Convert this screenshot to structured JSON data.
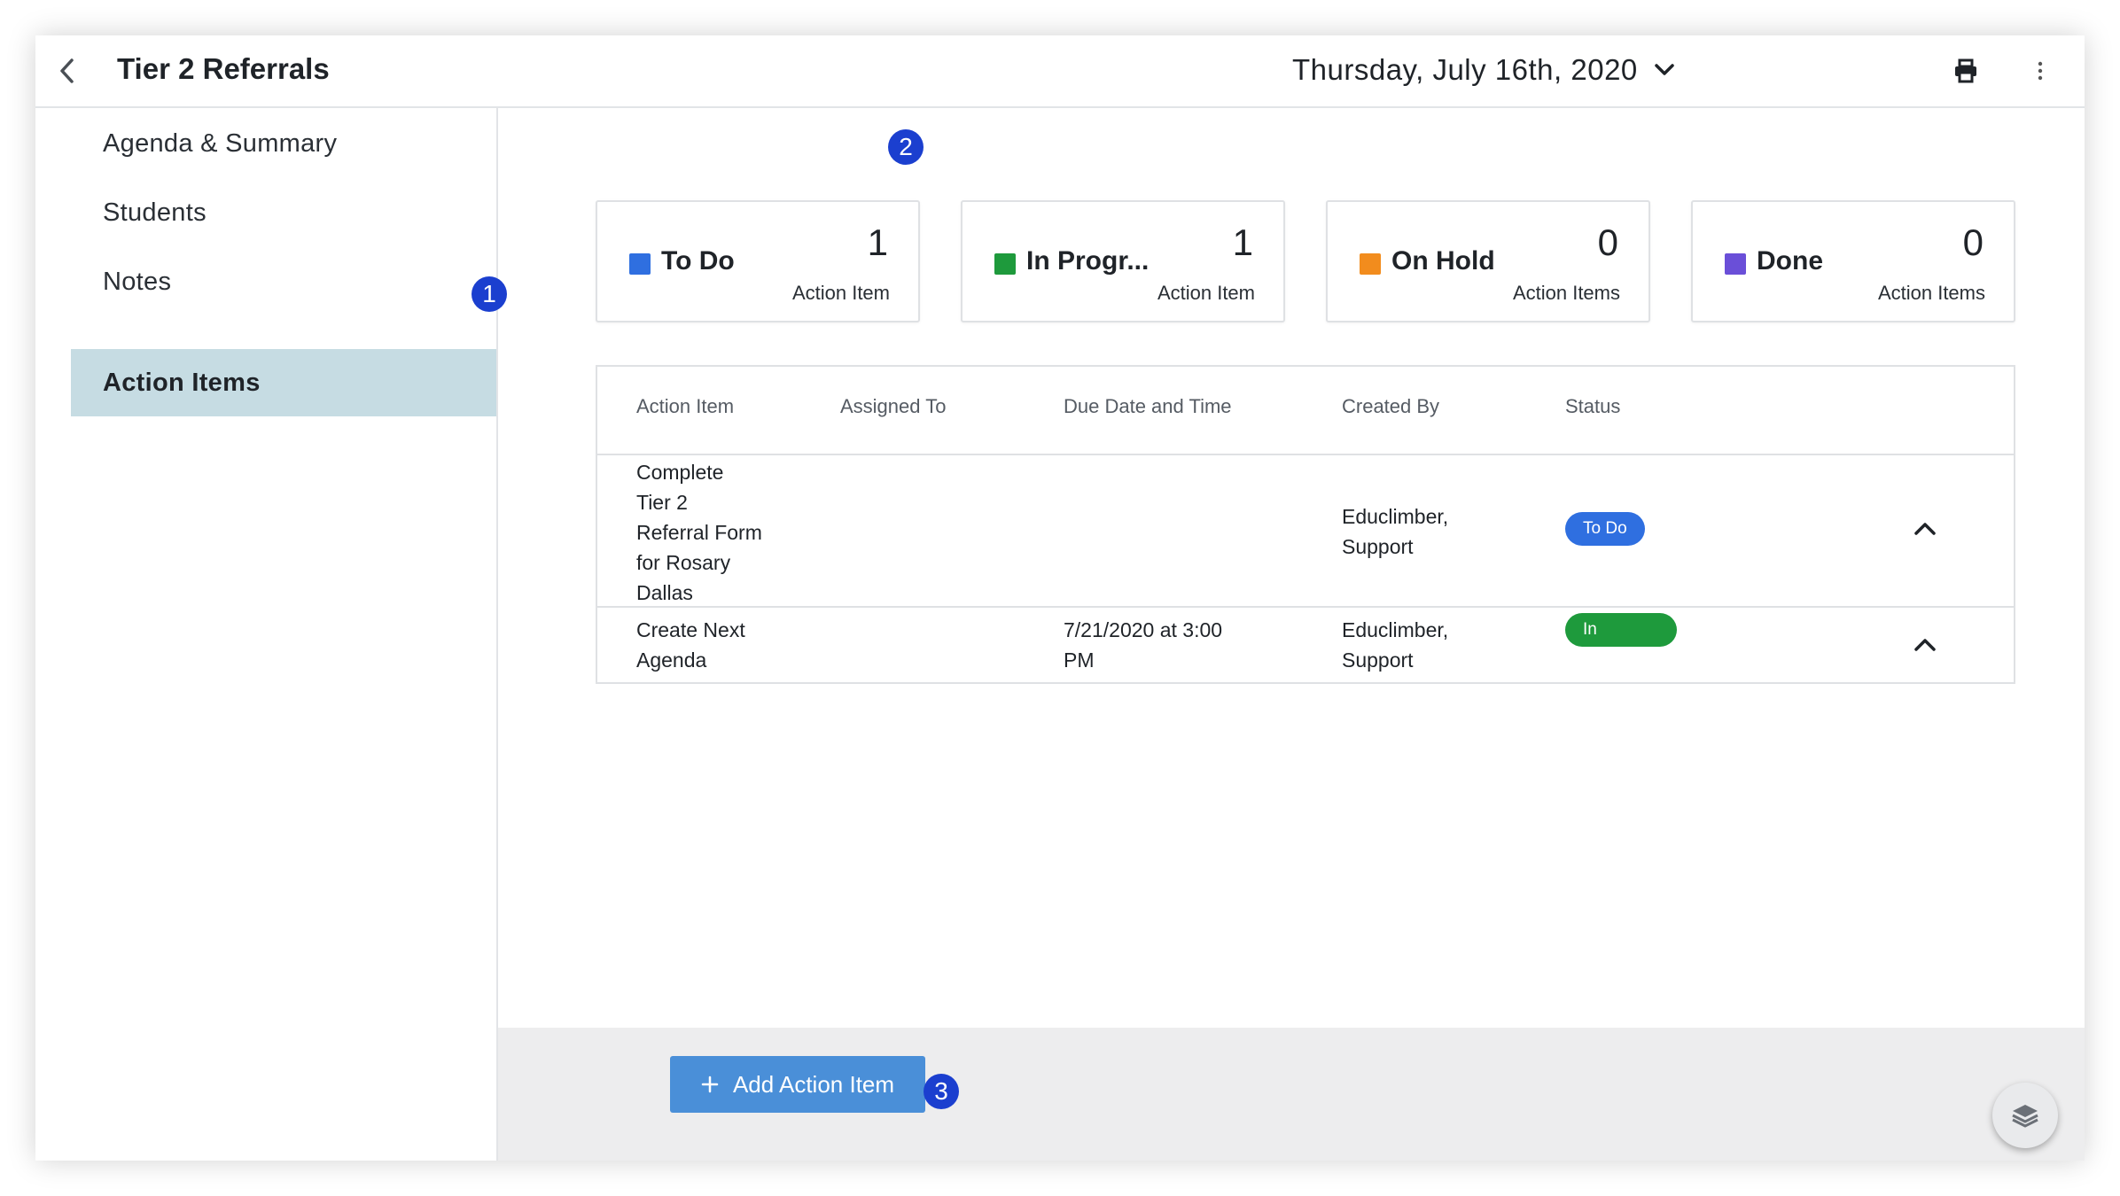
{
  "header": {
    "title": "Tier 2 Referrals",
    "date": "Thursday, July 16th, 2020"
  },
  "sidebar": {
    "items": [
      {
        "label": "Agenda & Summary"
      },
      {
        "label": "Students"
      },
      {
        "label": "Notes"
      },
      {
        "label": "Action Items",
        "active": true
      }
    ]
  },
  "summary_cards": [
    {
      "label": "To Do",
      "count": "1",
      "unit": "Action Item",
      "color": "#2f6fe0"
    },
    {
      "label": "In Progr...",
      "count": "1",
      "unit": "Action Item",
      "color": "#1e9a3c"
    },
    {
      "label": "On Hold",
      "count": "0",
      "unit": "Action Items",
      "color": "#f28c1d"
    },
    {
      "label": "Done",
      "count": "0",
      "unit": "Action Items",
      "color": "#6a4fd8"
    }
  ],
  "table": {
    "columns": [
      "Action Item",
      "Assigned To",
      "Due Date and Time",
      "Created By",
      "Status"
    ],
    "rows": [
      {
        "action_item": [
          "Complete",
          "Tier 2",
          "Referral Form",
          "for Rosary",
          "Dallas"
        ],
        "assigned_to": "",
        "due": [
          "",
          ""
        ],
        "created_by": [
          "Educlimber,",
          "Support"
        ],
        "status": "To Do",
        "status_color": "#2f6fe0"
      },
      {
        "action_item": [
          "Create Next",
          "Agenda"
        ],
        "assigned_to": "",
        "due": [
          "7/21/2020 at 3:00",
          "PM"
        ],
        "created_by": [
          "Educlimber,",
          "Support"
        ],
        "status": "In",
        "status_color": "#1e9a3c"
      }
    ]
  },
  "footer": {
    "add_button_label": "Add Action Item"
  },
  "badges": [
    "1",
    "2",
    "3"
  ],
  "icons": {
    "back": "chevron-left-icon",
    "date_dropdown": "chevron-down-icon",
    "print": "printer-icon",
    "more": "more-vertical-icon",
    "row_toggle": "chevron-up-icon",
    "add": "plus-icon",
    "fab": "layers-icon"
  }
}
